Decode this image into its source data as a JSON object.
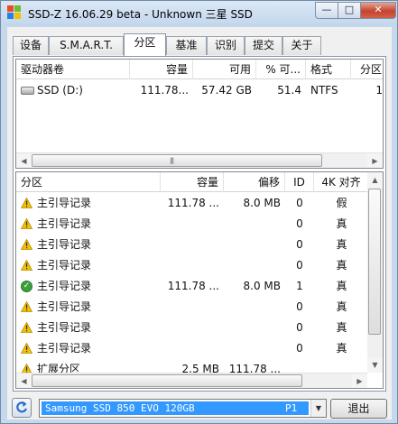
{
  "window": {
    "title": "SSD-Z 16.06.29 beta - Unknown 三星 SSD",
    "minimize_glyph": "—",
    "maximize_glyph": "□",
    "close_glyph": "✕",
    "app_icon": "ssd-z-app-icon"
  },
  "tabs": [
    {
      "label": "设备"
    },
    {
      "label": "S.M.A.R.T."
    },
    {
      "label": "分区",
      "active": true
    },
    {
      "label": "基准"
    },
    {
      "label": "识别"
    },
    {
      "label": "提交"
    },
    {
      "label": "关于"
    }
  ],
  "volumes": {
    "columns": [
      "驱动器卷",
      "容量",
      "可用",
      "% 可...",
      "格式",
      "分区"
    ],
    "rows": [
      {
        "icon": "drive-icon",
        "name": "SSD (D:)",
        "capacity": "111.78...",
        "free": "57.42 GB",
        "percent": "51.4",
        "format": "NTFS",
        "partition": "1"
      }
    ]
  },
  "partitions": {
    "columns": [
      "分区",
      "容量",
      "偏移",
      "ID",
      "4K 对齐"
    ],
    "rows": [
      {
        "icon": "warning-icon",
        "name": "主引导记录",
        "capacity": "111.78 ...",
        "offset": "8.0 MB",
        "id": "0",
        "aligned": "假"
      },
      {
        "icon": "warning-icon",
        "name": "主引导记录",
        "capacity": "",
        "offset": "",
        "id": "0",
        "aligned": "真"
      },
      {
        "icon": "warning-icon",
        "name": "主引导记录",
        "capacity": "",
        "offset": "",
        "id": "0",
        "aligned": "真"
      },
      {
        "icon": "warning-icon",
        "name": "主引导记录",
        "capacity": "",
        "offset": "",
        "id": "0",
        "aligned": "真"
      },
      {
        "icon": "check-icon",
        "name": "主引导记录",
        "capacity": "111.78 ...",
        "offset": "8.0 MB",
        "id": "1",
        "aligned": "真"
      },
      {
        "icon": "warning-icon",
        "name": "主引导记录",
        "capacity": "",
        "offset": "",
        "id": "0",
        "aligned": "真"
      },
      {
        "icon": "warning-icon",
        "name": "主引导记录",
        "capacity": "",
        "offset": "",
        "id": "0",
        "aligned": "真"
      },
      {
        "icon": "warning-icon",
        "name": "主引导记录",
        "capacity": "",
        "offset": "",
        "id": "0",
        "aligned": "真"
      },
      {
        "icon": "warning-icon",
        "name": "扩展分区",
        "capacity": "2.5 MB",
        "offset": "111.78 ...",
        "id": "",
        "aligned": ""
      }
    ]
  },
  "bottom": {
    "drive_select_value": "Samsung SSD 850 EVO 120GB",
    "drive_select_suffix": "P1",
    "exit_label": "退出",
    "refresh_icon": "refresh-icon"
  },
  "colors": {
    "selection": "#3399ff",
    "window_frame": "#c5d8ec",
    "warning": "#f2c200",
    "ok": "#3aa03a"
  }
}
